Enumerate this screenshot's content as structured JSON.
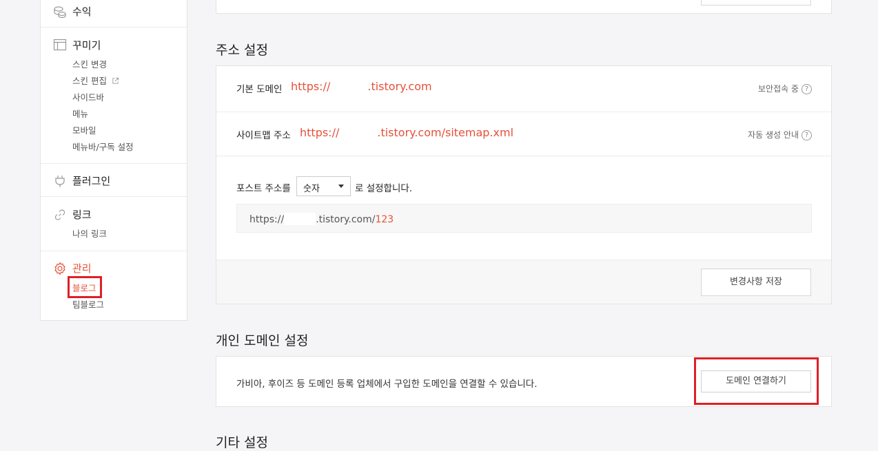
{
  "sidebar": {
    "revenue": "수익",
    "decorate": {
      "title": "꾸미기",
      "items": [
        "스킨 변경",
        "스킨 편집",
        "사이드바",
        "메뉴",
        "모바일",
        "메뉴바/구독 설정"
      ]
    },
    "plugin": "플러그인",
    "link": {
      "title": "링크",
      "items": [
        "나의 링크"
      ]
    },
    "manage": {
      "title": "관리",
      "items": [
        "블로그",
        "팀블로그"
      ]
    }
  },
  "address": {
    "title": "주소 설정",
    "default_domain": {
      "label": "기본 도메인",
      "prefix": "https://",
      "suffix": ".tistory.com",
      "hint": "보안접속 중"
    },
    "sitemap": {
      "label": "사이트맵 주소",
      "prefix": "https://",
      "suffix": ".tistory.com/sitemap.xml",
      "hint": "자동 생성 안내"
    },
    "post": {
      "label": "포스트 주소를",
      "select_value": "숫자",
      "suffix_text": "로 설정합니다.",
      "preview_prefix": "https://",
      "preview_domain": ".tistory.com/",
      "preview_number": "123"
    },
    "save_button": "변경사항 저장"
  },
  "custom_domain": {
    "title": "개인 도메인 설정",
    "description": "가비아, 후이즈 등 도메인 등록 업체에서 구입한 도메인을 연결할 수 있습니다.",
    "connect_button": "도메인 연결하기"
  },
  "other": {
    "title": "기타 설정"
  },
  "colors": {
    "accent": "#e55039",
    "highlight_box": "#e01e26"
  },
  "question_mark": "?"
}
